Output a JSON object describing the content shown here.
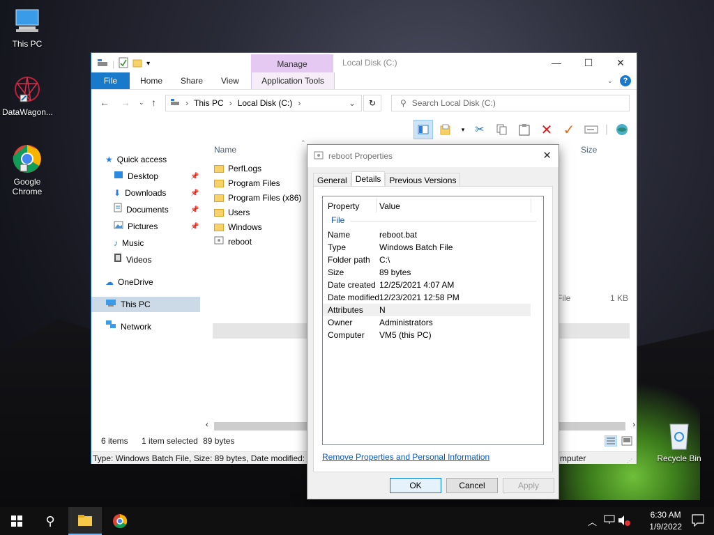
{
  "desktop": {
    "icons": [
      {
        "label": "This PC"
      },
      {
        "label": "DataWagon..."
      },
      {
        "label": "Google Chrome"
      },
      {
        "label": "Recycle Bin"
      }
    ]
  },
  "explorer": {
    "title": "Local Disk (C:)",
    "manage_tab": "Manage",
    "tabs": {
      "file": "File",
      "home": "Home",
      "share": "Share",
      "view": "View",
      "app_tools": "Application Tools"
    },
    "address": {
      "seg1": "This PC",
      "seg2": "Local Disk (C:)"
    },
    "search_placeholder": "Search Local Disk (C:)",
    "nav": {
      "quick_access": "Quick access",
      "desktop": "Desktop",
      "downloads": "Downloads",
      "documents": "Documents",
      "pictures": "Pictures",
      "music": "Music",
      "videos": "Videos",
      "onedrive": "OneDrive",
      "this_pc": "This PC",
      "network": "Network"
    },
    "columns": {
      "name": "Name",
      "size": "Size"
    },
    "files": [
      {
        "name": "PerfLogs"
      },
      {
        "name": "Program Files"
      },
      {
        "name": "Program Files (x86)"
      },
      {
        "name": "Users"
      },
      {
        "name": "Windows"
      },
      {
        "name": "reboot",
        "type_tail": "File",
        "size": "1 KB"
      }
    ],
    "status": {
      "items": "6 items",
      "selected": "1 item selected",
      "size": "89 bytes"
    },
    "details_bar": "Type: Windows Batch File, Size: 89 bytes, Date modified: 12",
    "details_bar_right": "mputer"
  },
  "dialog": {
    "title": "reboot Properties",
    "tabs": {
      "general": "General",
      "details": "Details",
      "previous": "Previous Versions"
    },
    "headers": {
      "property": "Property",
      "value": "Value"
    },
    "section": "File",
    "rows": [
      {
        "k": "Name",
        "v": "reboot.bat"
      },
      {
        "k": "Type",
        "v": "Windows Batch File"
      },
      {
        "k": "Folder path",
        "v": "C:\\"
      },
      {
        "k": "Size",
        "v": "89 bytes"
      },
      {
        "k": "Date created",
        "v": "12/25/2021 4:07 AM"
      },
      {
        "k": "Date modified",
        "v": "12/23/2021 12:58 PM"
      },
      {
        "k": "Attributes",
        "v": "N"
      },
      {
        "k": "Owner",
        "v": "Administrators"
      },
      {
        "k": "Computer",
        "v": "VM5 (this PC)"
      }
    ],
    "remove_link": "Remove Properties and Personal Information",
    "buttons": {
      "ok": "OK",
      "cancel": "Cancel",
      "apply": "Apply"
    }
  },
  "taskbar": {
    "time": "6:30 AM",
    "date": "1/9/2022"
  },
  "colors": {
    "accent": "#1979ca",
    "manage": "#e5c9f2",
    "selected_row": "#e5e5e5",
    "link": "#0a58c8"
  }
}
